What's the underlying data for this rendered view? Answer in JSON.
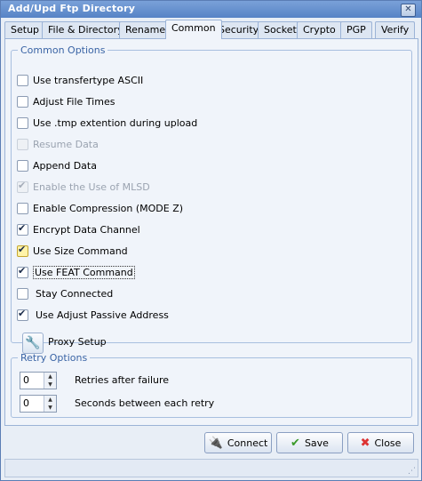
{
  "window": {
    "title": "Add/Upd Ftp Directory",
    "close_glyph": "✕"
  },
  "tabs": [
    {
      "label": "Setup"
    },
    {
      "label": "File & Directory"
    },
    {
      "label": "Rename"
    },
    {
      "label": "Common"
    },
    {
      "label": "Security"
    },
    {
      "label": "Socket"
    },
    {
      "label": "Crypto"
    },
    {
      "label": "PGP"
    },
    {
      "label": "Verify"
    }
  ],
  "common_options": {
    "legend": "Common Options",
    "items": [
      {
        "label": "Use transfertype ASCII",
        "checked": false
      },
      {
        "label": "Adjust File Times",
        "checked": false
      },
      {
        "label": "Use .tmp extention during upload",
        "checked": false
      },
      {
        "label": "Resume Data",
        "checked": false,
        "disabled": true
      },
      {
        "label": "Append Data",
        "checked": false
      },
      {
        "label": "Enable the Use of MLSD",
        "checked": true,
        "disabled": true
      },
      {
        "label": "Enable Compression (MODE Z)",
        "checked": false
      },
      {
        "label": "Encrypt Data Channel",
        "checked": true
      },
      {
        "label": "Use Size Command",
        "checked": true
      },
      {
        "label": "Use FEAT Command",
        "checked": true
      },
      {
        "label": "Stay Connected",
        "checked": false
      },
      {
        "label": "Use Adjust Passive Address",
        "checked": true
      }
    ],
    "proxy_setup_label": "Proxy Setup",
    "proxy_icon": "wrench-icon"
  },
  "retry_options": {
    "legend": "Retry Options",
    "retries_value": "0",
    "retries_label": "Retries after failure",
    "seconds_value": "0",
    "seconds_label": "Seconds between each retry"
  },
  "buttons": {
    "connect": "Connect",
    "save": "Save",
    "close": "Close"
  }
}
